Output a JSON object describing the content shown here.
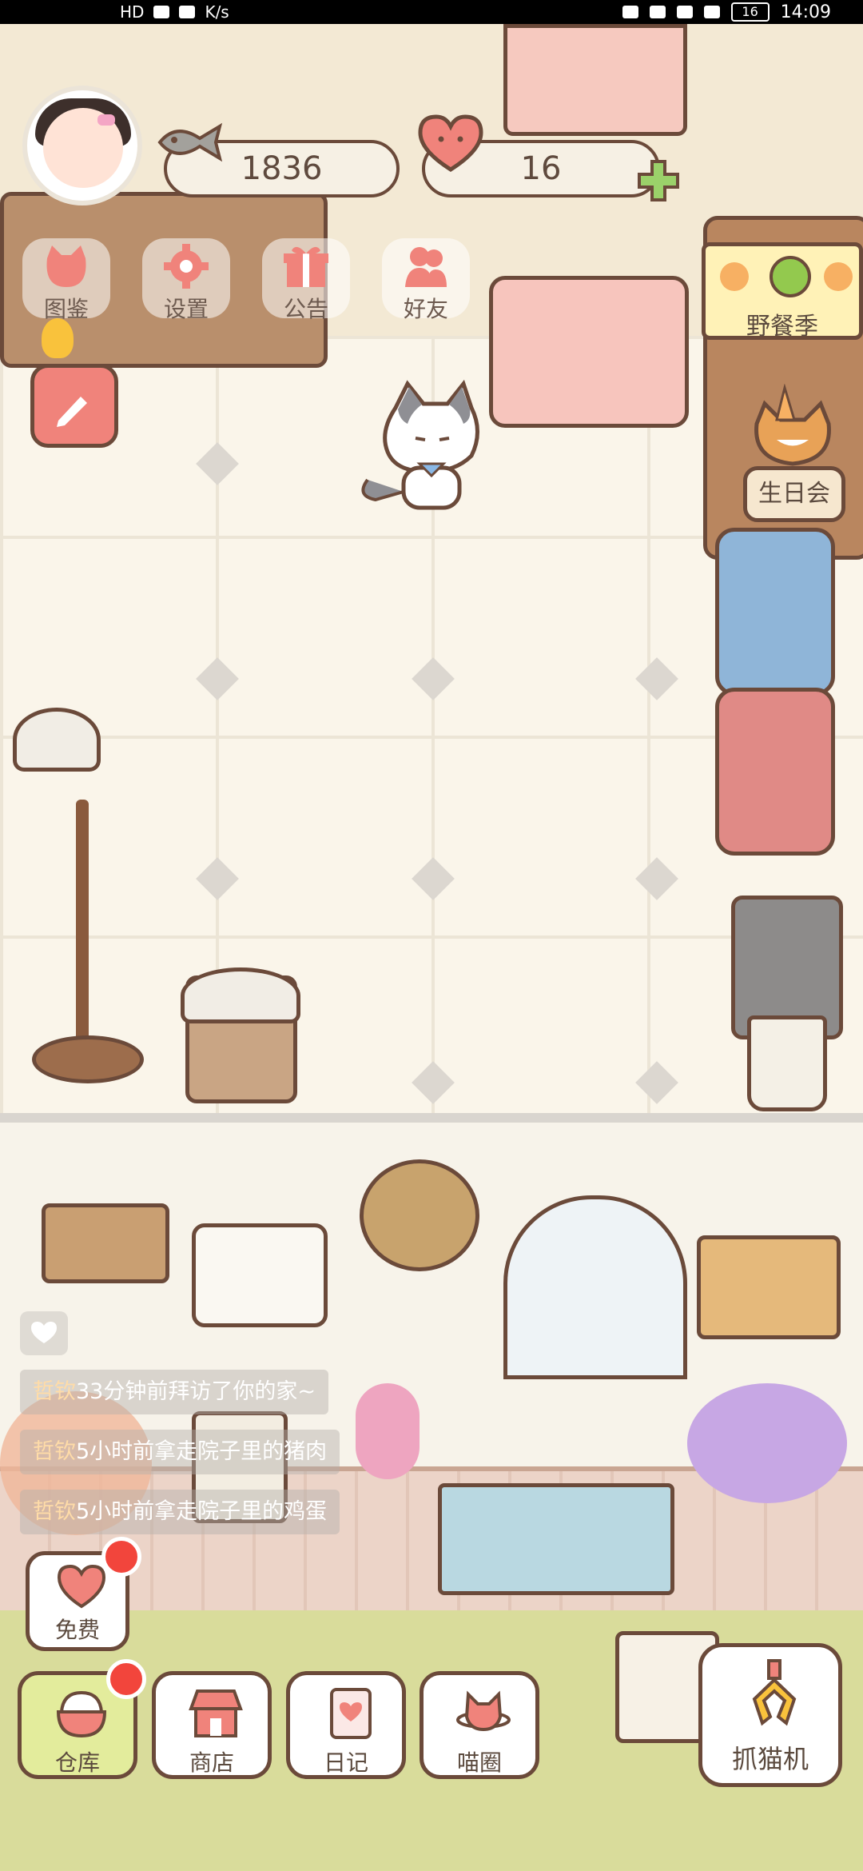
{
  "status_bar": {
    "network_label": "HD",
    "speed_unit": "K/s",
    "battery": "16",
    "time": "14:09"
  },
  "hud": {
    "fish_count": "1836",
    "heart_count": "16"
  },
  "top_menu": [
    {
      "label": "图鉴",
      "icon": "cat-book-icon"
    },
    {
      "label": "设置",
      "icon": "gear-icon"
    },
    {
      "label": "公告",
      "icon": "gift-icon"
    },
    {
      "label": "好友",
      "icon": "friends-icon"
    }
  ],
  "events": {
    "picnic_label": "野餐季",
    "birthday_label": "生日会"
  },
  "messages": [
    {
      "name": "哲钦",
      "text": "33分钟前拜访了你的家~"
    },
    {
      "name": "哲钦",
      "text": "5小时前拿走院子里的猪肉"
    },
    {
      "name": "哲钦",
      "text": "5小时前拿走院子里的鸡蛋"
    }
  ],
  "free_button": {
    "label": "免费"
  },
  "bottom_nav": [
    {
      "label": "仓库",
      "icon": "rice-bowl-icon",
      "badge": true
    },
    {
      "label": "商店",
      "icon": "shop-icon",
      "badge": false
    },
    {
      "label": "日记",
      "icon": "diary-icon",
      "badge": false
    },
    {
      "label": "喵圈",
      "icon": "cat-planet-icon",
      "badge": false
    }
  ],
  "claw_machine": {
    "label": "抓猫机"
  },
  "colors": {
    "outline": "#6b4a3a",
    "accent_coral": "#f0837b",
    "badge_red": "#f2453c",
    "plus_green": "#9bd16a"
  }
}
